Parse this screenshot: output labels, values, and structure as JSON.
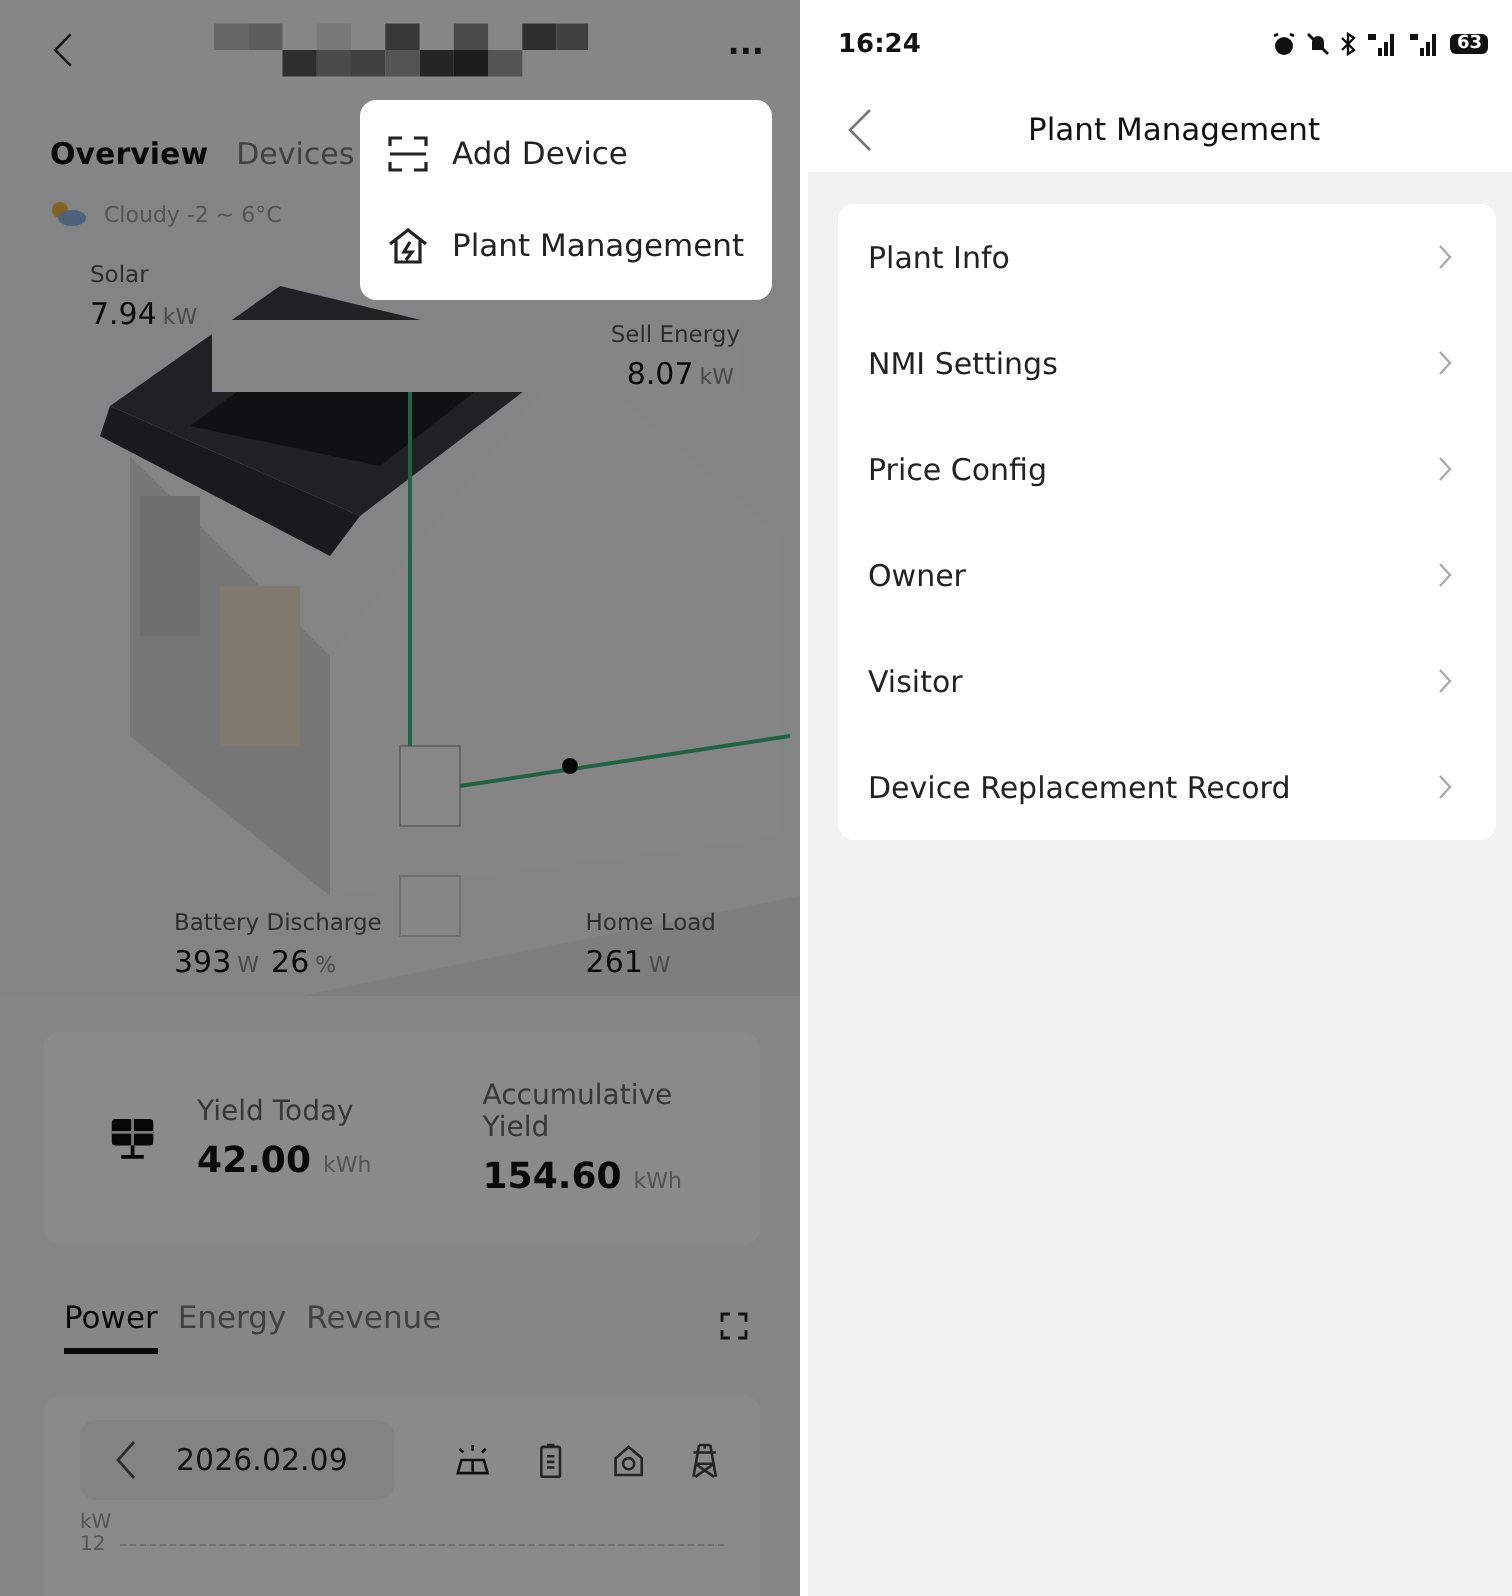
{
  "left_screen": {
    "more": "···",
    "tabs": [
      {
        "label": "Overview",
        "selected": true
      },
      {
        "label": "Devices",
        "selected": false
      }
    ],
    "weather": "Cloudy -2 ~ 6°C",
    "flow_stats": [
      {
        "label": "Solar",
        "values": [
          {
            "value": "7.94",
            "unit": "kW"
          }
        ]
      },
      {
        "label": "Sell Energy",
        "values": [
          {
            "value": "8.07",
            "unit": "kW"
          }
        ]
      },
      {
        "label": "Battery Discharge",
        "values": [
          {
            "value": "393",
            "unit": "W"
          },
          {
            "value": "26",
            "unit": "%"
          }
        ]
      },
      {
        "label": "Home Load",
        "values": [
          {
            "value": "261",
            "unit": "W"
          }
        ]
      }
    ],
    "yield": [
      {
        "label": "Yield Today",
        "value": "42.00",
        "unit": "kWh"
      },
      {
        "label": "Accumulative Yield",
        "value": "154.60",
        "unit": "kWh"
      }
    ],
    "chart_tabs": [
      {
        "label": "Power",
        "selected": true
      },
      {
        "label": "Energy",
        "selected": false
      },
      {
        "label": "Revenue",
        "selected": false
      }
    ],
    "date": "2026.02.09",
    "chart_unit": "kW",
    "chart_tick": "12",
    "menu": [
      {
        "label": "Add Device",
        "kind": "scan"
      },
      {
        "label": "Plant Management",
        "kind": "plant"
      }
    ]
  },
  "right_screen": {
    "status_bar": {
      "time": "16:24",
      "battery": "63"
    },
    "title": "Plant Management",
    "items": [
      {
        "label": "Plant Info"
      },
      {
        "label": "NMI Settings"
      },
      {
        "label": "Price Config"
      },
      {
        "label": "Owner"
      },
      {
        "label": "Visitor"
      },
      {
        "label": "Device Replacement Record"
      }
    ]
  }
}
